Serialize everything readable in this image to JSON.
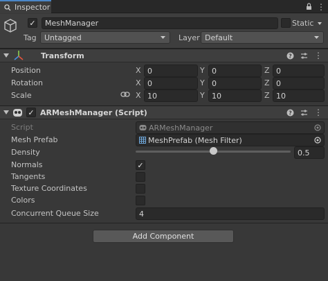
{
  "tab": {
    "title": "Inspector"
  },
  "object": {
    "name": "MeshManager",
    "static_label": "Static",
    "tag_label": "Tag",
    "tag_value": "Untagged",
    "layer_label": "Layer",
    "layer_value": "Default"
  },
  "transform": {
    "title": "Transform",
    "rows": [
      {
        "label": "Position",
        "x": "0",
        "y": "0",
        "z": "0"
      },
      {
        "label": "Rotation",
        "x": "0",
        "y": "0",
        "z": "0"
      },
      {
        "label": "Scale",
        "x": "10",
        "y": "10",
        "z": "10"
      }
    ],
    "axes": [
      "X",
      "Y",
      "Z"
    ]
  },
  "armesh": {
    "title": "ARMeshManager (Script)",
    "script_label": "Script",
    "script_value": "ARMeshManager",
    "mesh_prefab_label": "Mesh Prefab",
    "mesh_prefab_value": "MeshPrefab (Mesh Filter)",
    "density_label": "Density",
    "density_value": "0.5",
    "density_fraction": 0.5,
    "normals_label": "Normals",
    "normals_checked": true,
    "tangents_label": "Tangents",
    "texcoords_label": "Texture Coordinates",
    "colors_label": "Colors",
    "queue_label": "Concurrent Queue Size",
    "queue_value": "4"
  },
  "add_component": "Add Component",
  "icons": {
    "tab": "inspector-icon",
    "lock": "lock-icon",
    "menu": "kebab-menu-icon",
    "gameobject": "cube-icon",
    "help": "help-icon",
    "presets": "sliders-icon",
    "link": "link-icon"
  },
  "colors": {
    "accent": "#4a86c8",
    "panel": "#383838",
    "header": "#3e3e3e"
  }
}
